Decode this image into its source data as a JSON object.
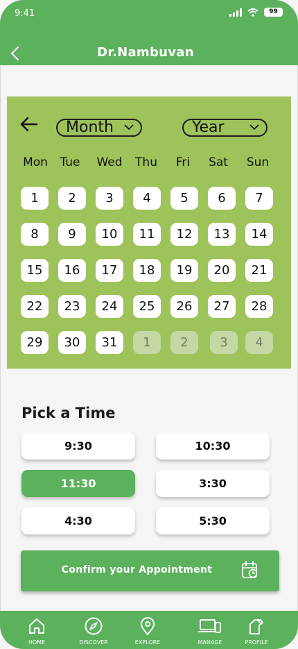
{
  "status_bar": {
    "time": "9:41",
    "battery": "99"
  },
  "header": {
    "title": "Dr.Nambuvan"
  },
  "calendar": {
    "month_label": "Month",
    "year_label": "Year",
    "weekdays": [
      "Mon",
      "Tue",
      "Wed",
      "Thu",
      "Fri",
      "Sat",
      "Sun"
    ],
    "days": [
      "1",
      "2",
      "3",
      "4",
      "5",
      "6",
      "7",
      "8",
      "9",
      "10",
      "11",
      "12",
      "13",
      "14",
      "15",
      "16",
      "17",
      "18",
      "19",
      "20",
      "21",
      "22",
      "23",
      "24",
      "25",
      "26",
      "27",
      "28",
      "29",
      "30",
      "31"
    ],
    "next_month_days": [
      "1",
      "2",
      "3",
      "4"
    ]
  },
  "time_picker": {
    "title": "Pick a Time",
    "slots": [
      "9:30",
      "10:30",
      "11:30",
      "3:30",
      "4:30",
      "5:30"
    ],
    "selected": "11:30"
  },
  "confirm": {
    "label": "Confirm  your Appointment"
  },
  "nav": {
    "items": [
      {
        "label": "HOME",
        "icon": "home-icon"
      },
      {
        "label": "DISCOVER",
        "icon": "compass-icon"
      },
      {
        "label": "EXPLORE",
        "icon": "location-pin-icon"
      },
      {
        "label": "MANAGE",
        "icon": "devices-icon"
      },
      {
        "label": "PROFILE",
        "icon": "profile-icon"
      }
    ]
  },
  "colors": {
    "primary_green": "#5cb15c",
    "calendar_green": "#9ec35a",
    "muted_day": "#c3d8a4"
  }
}
